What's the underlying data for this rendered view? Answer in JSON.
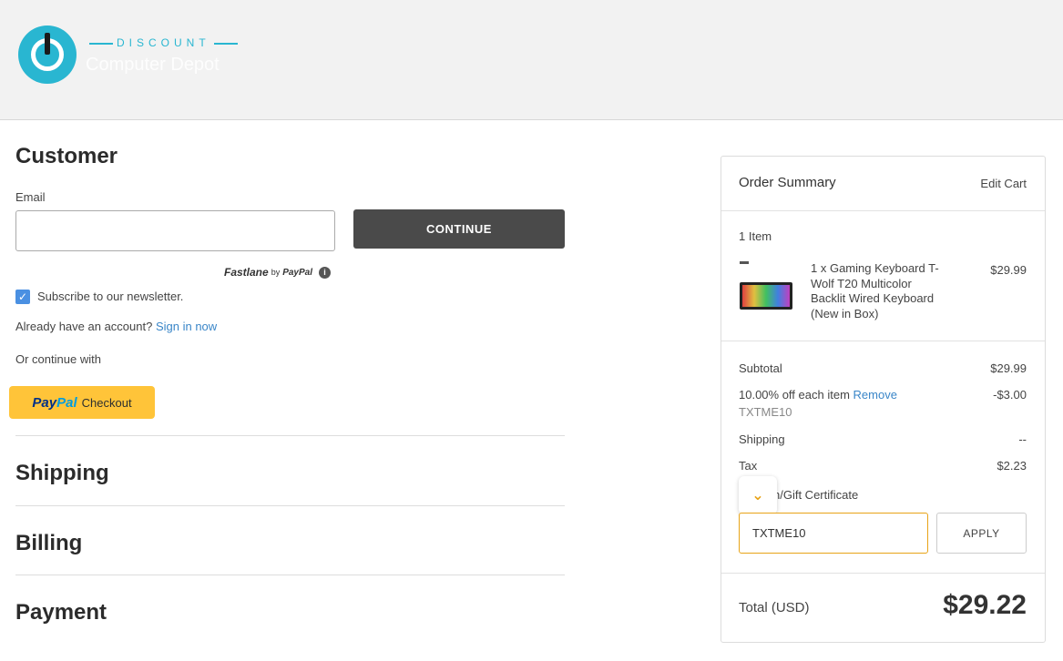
{
  "header": {
    "brand_top": "DISCOUNT",
    "brand_sub": "Computer Depot"
  },
  "customer": {
    "title": "Customer",
    "email_label": "Email",
    "email_value": "",
    "continue_label": "CONTINUE",
    "fastlane_label": "Fastlane",
    "fastlane_by": "by",
    "fastlane_paypal": "PayPal",
    "newsletter_label": "Subscribe to our newsletter.",
    "newsletter_checked": true,
    "account_prompt": "Already have an account?",
    "signin_label": "Sign in now",
    "or_continue": "Or continue with",
    "paypal_pay": "Pay",
    "paypal_pal": "Pal",
    "paypal_checkout": "Checkout"
  },
  "sections": {
    "shipping": "Shipping",
    "billing": "Billing",
    "payment": "Payment"
  },
  "summary": {
    "title": "Order Summary",
    "edit_cart": "Edit Cart",
    "item_count": "1 Item",
    "item_desc_1": "1 x Gaming Keyboard T-",
    "item_desc_2": "Wolf T20 Multicolor",
    "item_desc_3": "Backlit Wired Keyboard",
    "item_desc_4": "(New in Box)",
    "item_price": "$29.99",
    "subtotal_label": "Subtotal",
    "subtotal_value": "$29.99",
    "discount_label": "10.00% off each item",
    "discount_remove": "Remove",
    "discount_value": "-$3.00",
    "discount_code": "TXTME10",
    "shipping_label": "Shipping",
    "shipping_value": "--",
    "tax_label": "Tax",
    "tax_value": "$2.23",
    "coupon_label": "n/Gift Certificate",
    "coupon_value": "TXTME10",
    "apply_label": "APPLY",
    "total_label": "Total (USD)",
    "total_value": "$29.22"
  },
  "colors": {
    "accent": "#29b6d1",
    "link": "#3a86c8",
    "paypal_yellow": "#ffc439",
    "coupon_border": "#e8a317"
  }
}
